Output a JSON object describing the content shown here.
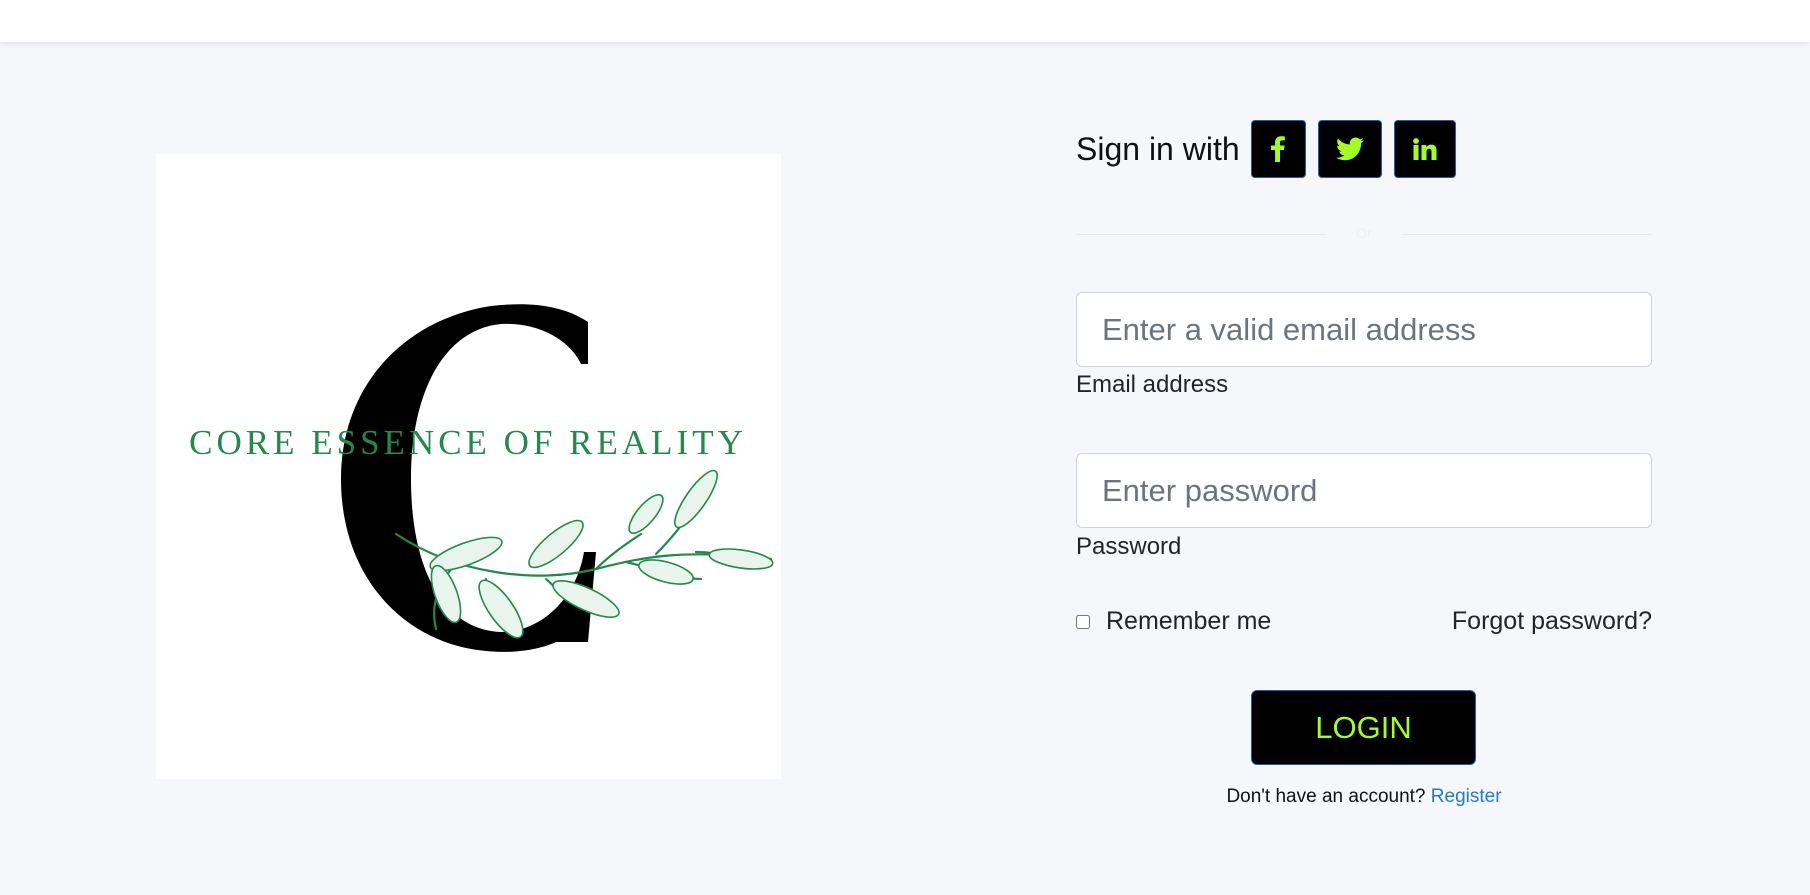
{
  "logo": {
    "brand_text": "CORE ESSENCE OF REALITY",
    "monogram": "C",
    "brand_color": "#1f8a4c"
  },
  "signin": {
    "label": "Sign in with",
    "socials": [
      {
        "name": "facebook",
        "icon": "facebook-icon"
      },
      {
        "name": "twitter",
        "icon": "twitter-icon"
      },
      {
        "name": "linkedin",
        "icon": "linkedin-icon"
      }
    ],
    "icon_color": "#a3ff1f"
  },
  "divider": {
    "label": "Or"
  },
  "email": {
    "placeholder": "Enter a valid email address",
    "value": "",
    "label": "Email address"
  },
  "password": {
    "placeholder": "Enter password",
    "value": "",
    "label": "Password"
  },
  "remember": {
    "label": "Remember me",
    "checked": false
  },
  "forgot": {
    "label": "Forgot password?"
  },
  "login": {
    "label": "LOGIN"
  },
  "register": {
    "prompt": "Don't have an account?",
    "link": "Register"
  },
  "colors": {
    "page_bg": "#f5f7fb",
    "button_bg": "#000000",
    "accent": "#a3ff1f",
    "link": "#1e7ad6"
  }
}
